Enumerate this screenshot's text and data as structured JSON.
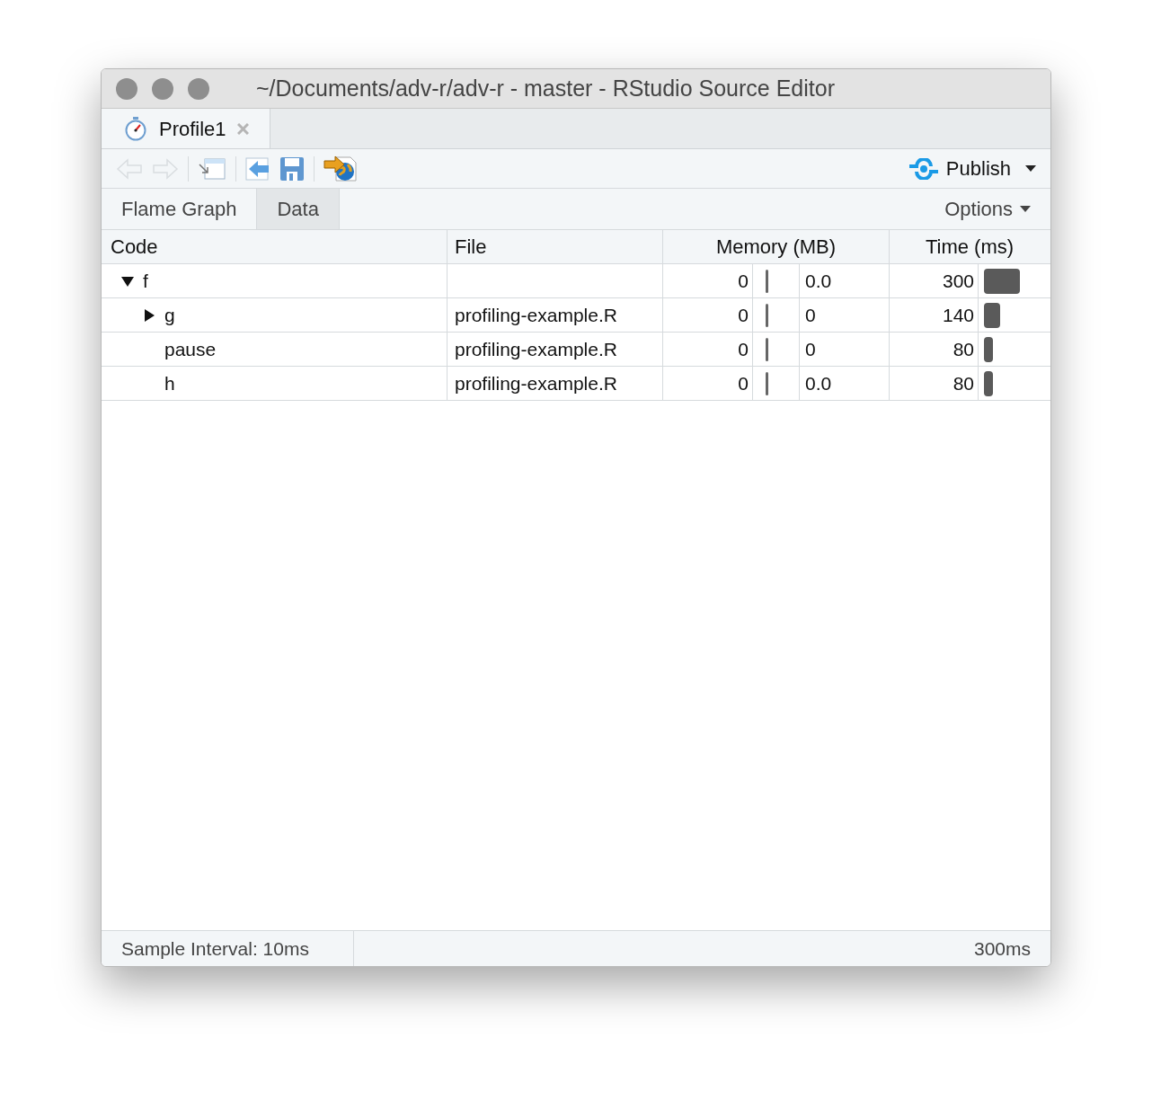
{
  "window": {
    "title": "~/Documents/adv-r/adv-r - master - RStudio Source Editor"
  },
  "doc_tab": {
    "label": "Profile1"
  },
  "toolbar": {
    "publish": "Publish"
  },
  "view_tabs": [
    {
      "label": "Flame Graph",
      "selected": false
    },
    {
      "label": "Data",
      "selected": true
    }
  ],
  "options": "Options",
  "table": {
    "columns": [
      "Code",
      "File",
      "Memory (MB)",
      "Time (ms)"
    ],
    "rows": [
      {
        "code": "f",
        "file": "",
        "mem": "0",
        "mem2": "0.0",
        "time": "300",
        "time_bar": {
          "level": 0.83
        },
        "expanded": true,
        "children": [
          {
            "code": "g",
            "file": "profiling-example.R",
            "mem": "0",
            "mem2": "0",
            "time": "140",
            "time_bar": {
              "level": 0.38
            },
            "expanded": false
          },
          {
            "code": "pause",
            "file": "profiling-example.R",
            "mem": "0",
            "mem2": "0",
            "time": "80",
            "time_bar": {
              "level": 0.21
            }
          },
          {
            "code": "h",
            "file": "profiling-example.R",
            "mem": "0",
            "mem2": "0.0",
            "time": "80",
            "time_bar": {
              "level": 0.21
            }
          }
        ]
      }
    ]
  },
  "status_bar": {
    "interval": "Sample Interval: 10ms",
    "total": "300ms"
  }
}
